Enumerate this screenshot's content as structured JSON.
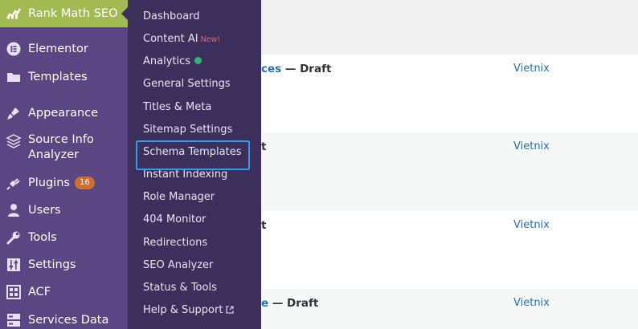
{
  "sidebar": {
    "active_item": "Rank Math SEO",
    "items": [
      {
        "label": "Elementor",
        "icon": "elementor-icon"
      },
      {
        "label": "Templates",
        "icon": "folder-icon"
      },
      {
        "label": "Appearance",
        "icon": "paintbrush-icon"
      },
      {
        "label": "Source Info",
        "label2": "Analyzer",
        "icon": "layers-icon"
      },
      {
        "label": "Plugins",
        "icon": "plugin-icon",
        "badge": "16"
      },
      {
        "label": "Users",
        "icon": "user-icon"
      },
      {
        "label": "Tools",
        "icon": "wrench-icon"
      },
      {
        "label": "Settings",
        "icon": "sliders-icon"
      },
      {
        "label": "ACF",
        "icon": "grid-icon"
      },
      {
        "label": "Services Data",
        "icon": "database-icon"
      }
    ]
  },
  "flyout": {
    "items": [
      {
        "label": "Dashboard"
      },
      {
        "label": "Content AI",
        "tag": "New!"
      },
      {
        "label": "Analytics"
      },
      {
        "label": "General Settings"
      },
      {
        "label": "Titles & Meta"
      },
      {
        "label": "Sitemap Settings"
      },
      {
        "label": "Schema Templates"
      },
      {
        "label": "Instant Indexing"
      },
      {
        "label": "Role Manager"
      },
      {
        "label": "404 Monitor"
      },
      {
        "label": "Redirections"
      },
      {
        "label": "SEO Analyzer"
      },
      {
        "label": "Status & Tools"
      },
      {
        "label": "Help & Support"
      }
    ],
    "highlighted_item": "Schema Templates"
  },
  "rows": [
    {
      "title_link": "ces",
      "title_suffix": " — Draft",
      "author": "Vietnix"
    },
    {
      "title_link": "",
      "title_suffix": "t",
      "author": "Vietnix"
    },
    {
      "title_link": "",
      "title_suffix": "t",
      "author": "Vietnix"
    },
    {
      "title_link": "e",
      "title_suffix": " — Draft",
      "author": "Vietnix"
    }
  ],
  "colors": {
    "sidebar_bg": "#594683",
    "flyout_bg": "#3d2f5c",
    "active_bg": "#a1bb52",
    "link": "#2271b1",
    "highlight_border": "#2b9cf2",
    "badge": "#d26e2c",
    "new_tag": "#f4606c",
    "analytics_dot": "#2cb574"
  }
}
